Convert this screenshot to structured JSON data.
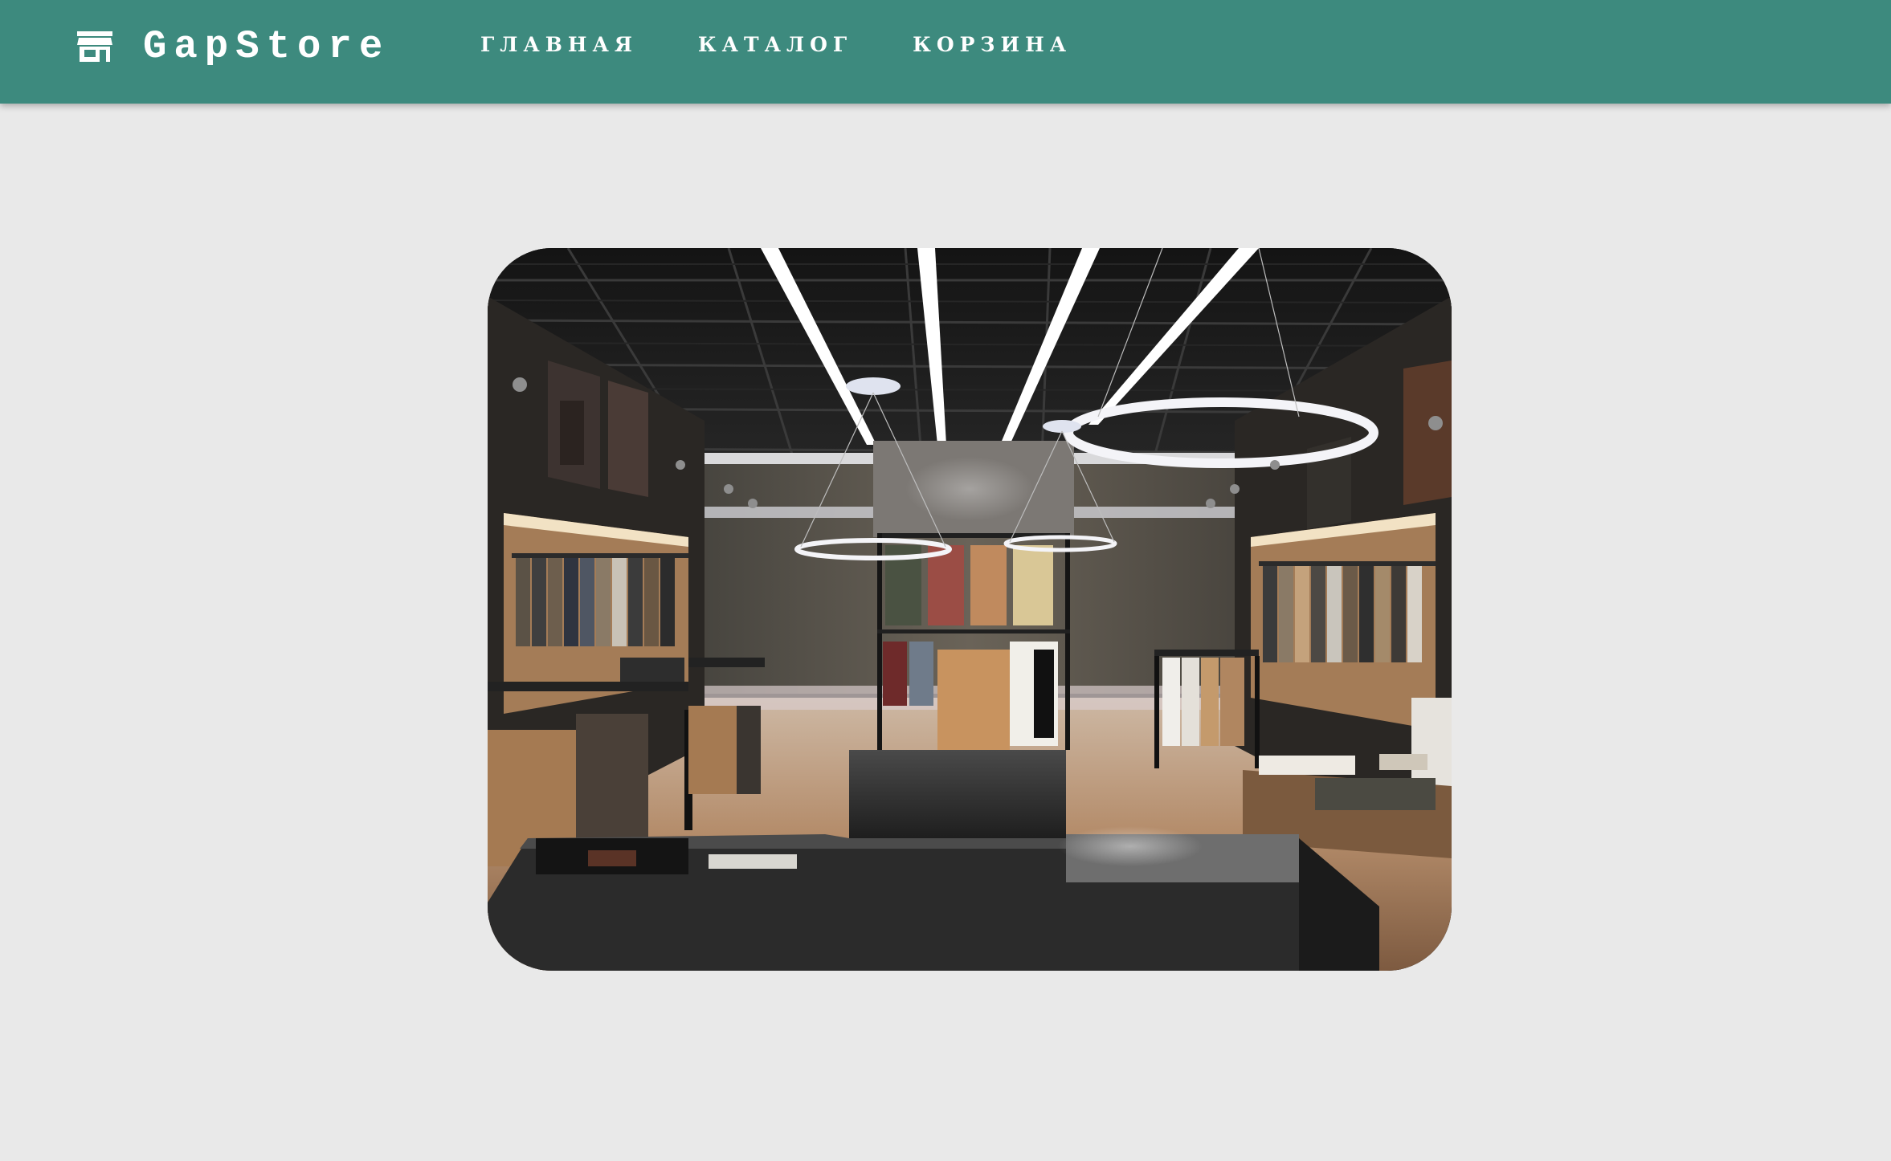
{
  "header": {
    "brand": {
      "name": "GapStore",
      "icon": "store-icon"
    },
    "nav": [
      {
        "label": "ГЛАВНАЯ"
      },
      {
        "label": "КАТАЛОГ"
      },
      {
        "label": "КОРЗИНА"
      }
    ]
  },
  "colors": {
    "header_bg": "#3d8a7e",
    "page_bg": "#e9e9e9",
    "nav_text": "#ffffff"
  }
}
